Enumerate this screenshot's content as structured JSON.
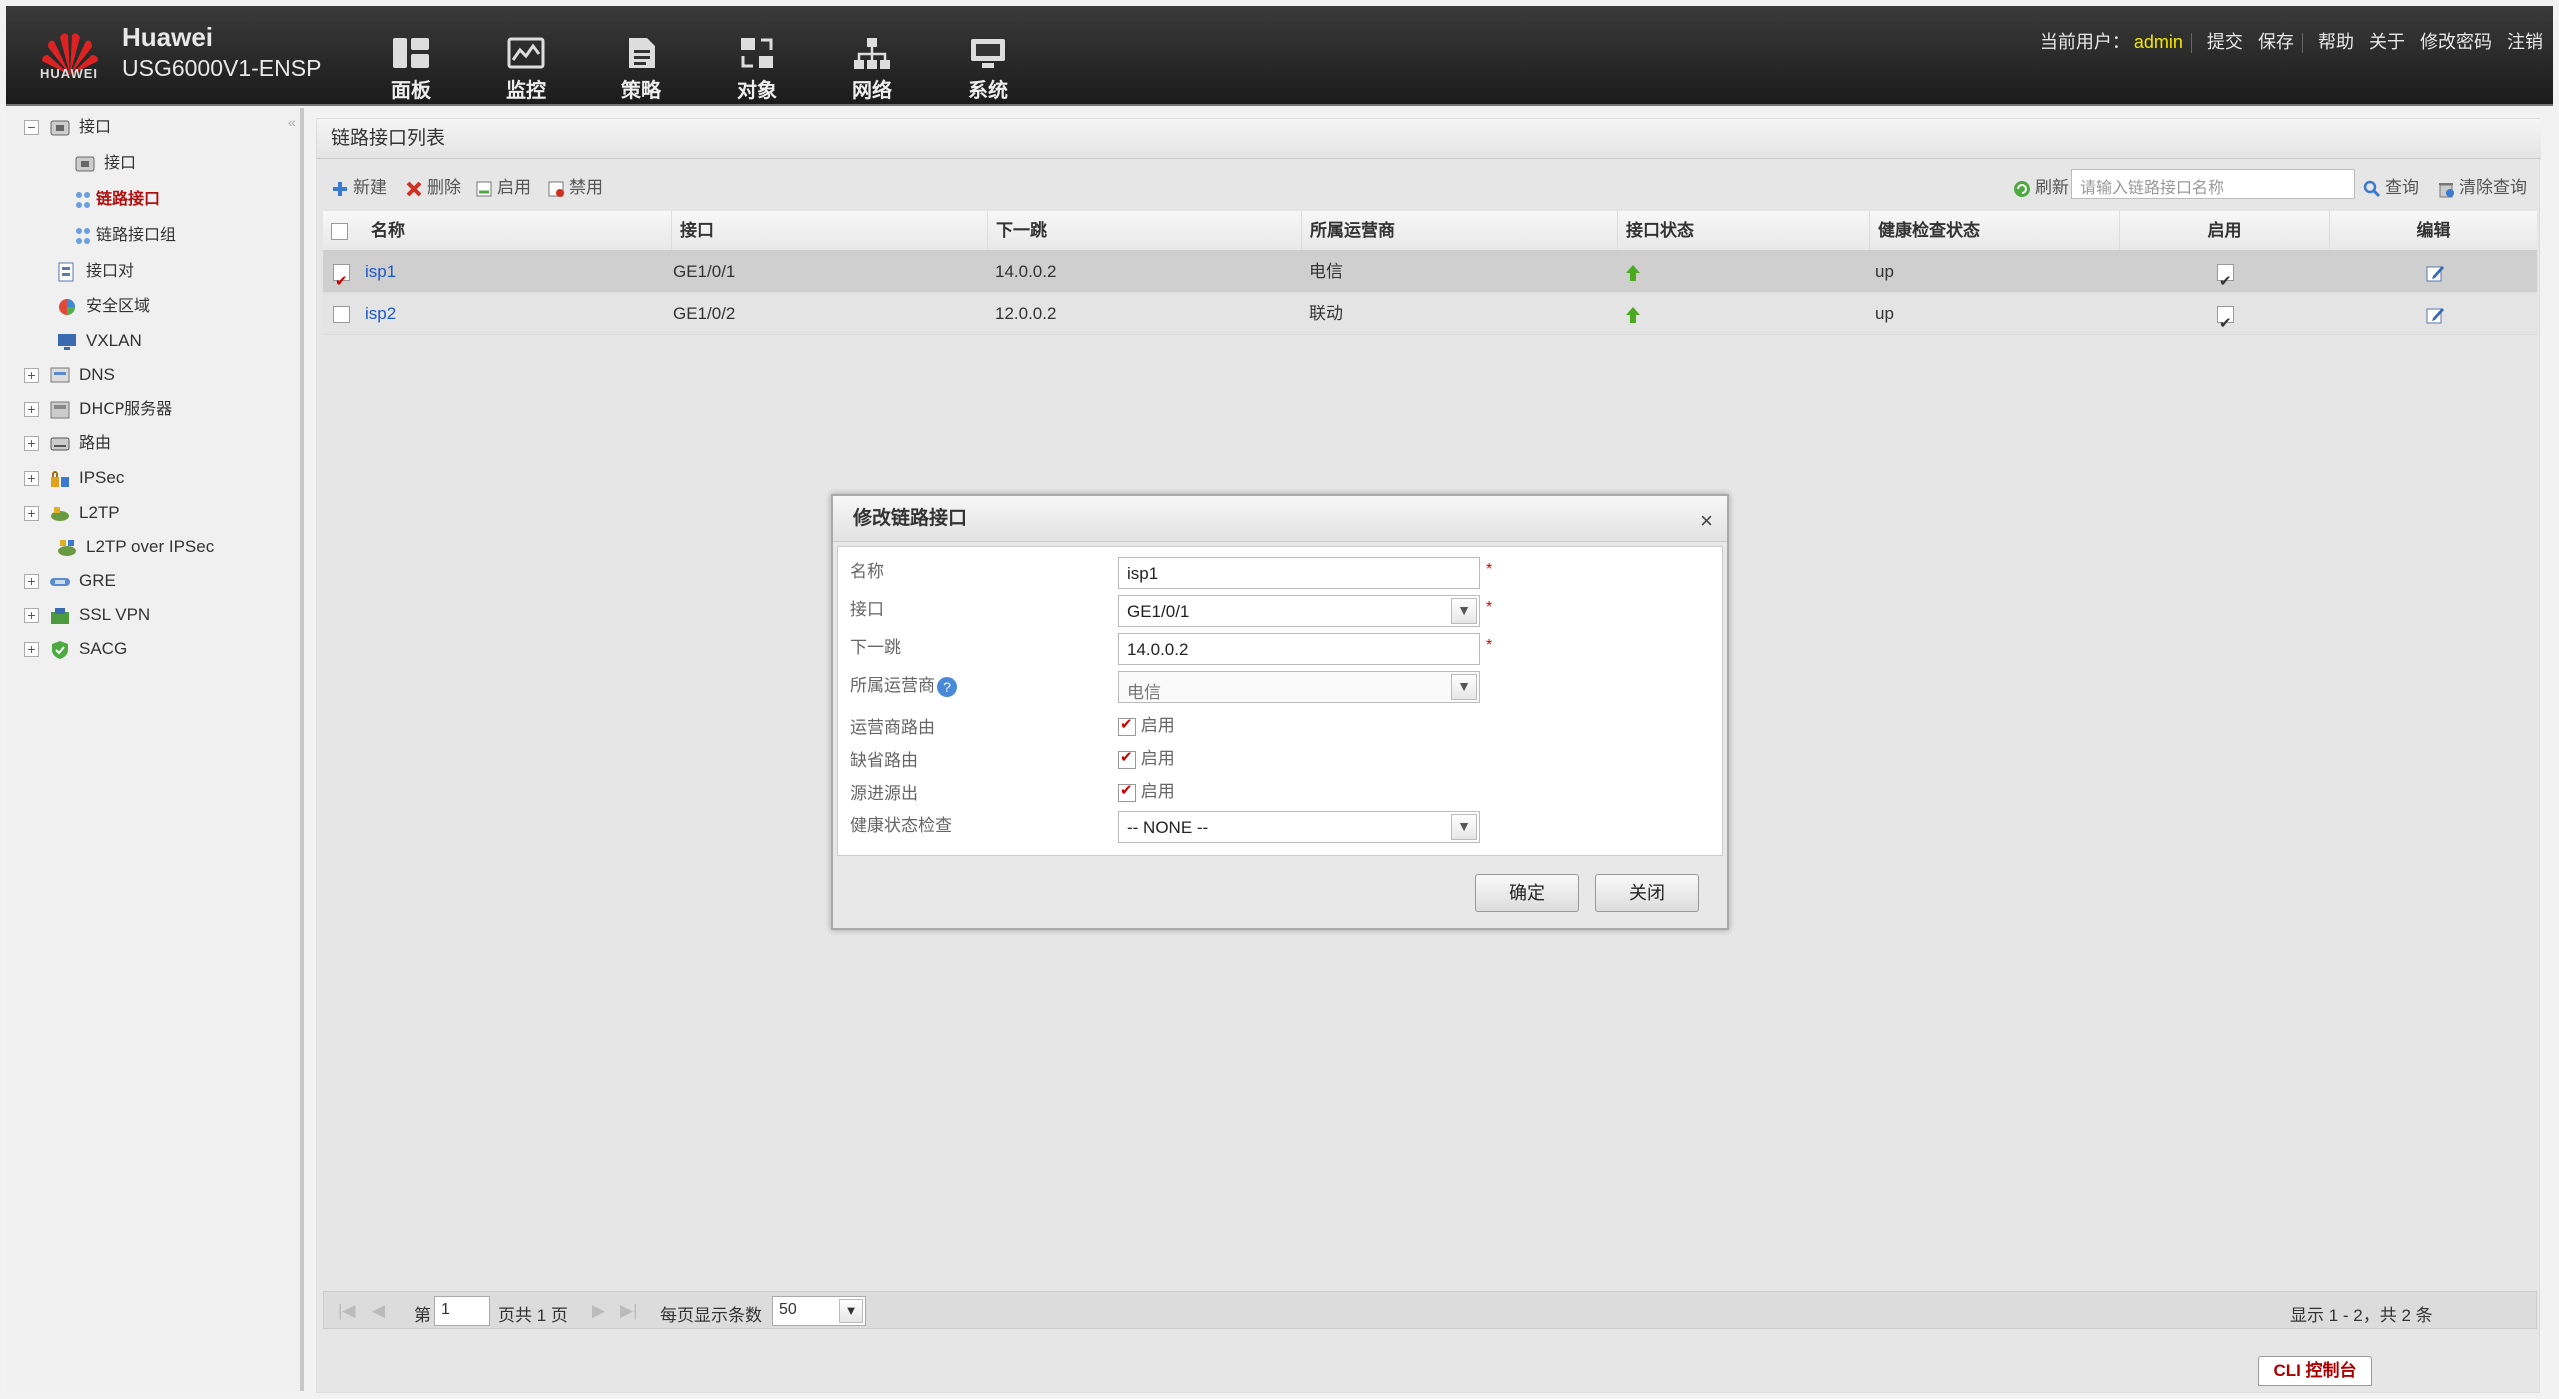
{
  "header": {
    "brand_name": "Huawei",
    "model": "USG6000V1-ENSP",
    "logo_text": "HUAWEI",
    "nav": [
      {
        "label": "面板",
        "icon": "dashboard-icon"
      },
      {
        "label": "监控",
        "icon": "monitor-icon"
      },
      {
        "label": "策略",
        "icon": "policy-icon"
      },
      {
        "label": "对象",
        "icon": "object-icon"
      },
      {
        "label": "网络",
        "icon": "network-icon"
      },
      {
        "label": "系统",
        "icon": "system-icon"
      }
    ],
    "user_label": "当前用户：",
    "user_name": "admin",
    "links": [
      "提交",
      "保存",
      "帮助",
      "关于",
      "修改密码",
      "注销"
    ],
    "user_color": "#f3e800"
  },
  "sidebar": {
    "collapse": "«",
    "items": [
      {
        "label": "接口",
        "pm": "−"
      },
      {
        "label": "接口"
      },
      {
        "label": "链路接口",
        "selected": true
      },
      {
        "label": "链路接口组"
      },
      {
        "label": "接口对"
      },
      {
        "label": "安全区域"
      },
      {
        "label": "VXLAN"
      },
      {
        "label": "DNS",
        "pm": "+"
      },
      {
        "label": "DHCP服务器",
        "pm": "+"
      },
      {
        "label": "路由",
        "pm": "+"
      },
      {
        "label": "IPSec",
        "pm": "+"
      },
      {
        "label": "L2TP",
        "pm": "+"
      },
      {
        "label": "L2TP over IPSec"
      },
      {
        "label": "GRE",
        "pm": "+"
      },
      {
        "label": "SSL VPN",
        "pm": "+"
      },
      {
        "label": "SACG",
        "pm": "+"
      }
    ]
  },
  "main": {
    "title": "链路接口列表",
    "toolbar": {
      "new": "新建",
      "delete": "删除",
      "enable": "启用",
      "disable": "禁用",
      "refresh": "刷新",
      "search_placeholder": "请输入链路接口名称",
      "query": "查询",
      "clear_query": "清除查询"
    },
    "columns": [
      "名称",
      "接口",
      "下一跳",
      "所属运营商",
      "接口状态",
      "健康检查状态",
      "启用",
      "编辑"
    ],
    "rows": [
      {
        "name": "isp1",
        "interface": "GE1/0/1",
        "next_hop": "14.0.0.2",
        "carrier": "电信",
        "status": "up-arrow",
        "health": "up",
        "enabled": true,
        "checked": true
      },
      {
        "name": "isp2",
        "interface": "GE1/0/2",
        "next_hop": "12.0.0.2",
        "carrier": "联动",
        "status": "up-arrow",
        "health": "up",
        "enabled": true,
        "checked": false
      }
    ],
    "pager": {
      "page_prefix": "第",
      "page": "1",
      "page_suffix": "页共 1 页",
      "per_page_label": "每页显示条数",
      "per_page": "50",
      "summary": "显示 1 - 2，共 2 条"
    }
  },
  "cli": "CLI 控制台",
  "dialog": {
    "title": "修改链路接口",
    "close": "×",
    "fields": {
      "name_label": "名称",
      "name_value": "isp1",
      "interface_label": "接口",
      "interface_value": "GE1/0/1",
      "next_hop_label": "下一跳",
      "next_hop_value": "14.0.0.2",
      "carrier_label": "所属运营商",
      "carrier_value": "电信",
      "carrier_route_label": "运营商路由",
      "default_route_label": "缺省路由",
      "source_in_out_label": "源进源出",
      "enable_text": "启用",
      "health_label": "健康状态检查",
      "health_value": "-- NONE --",
      "required": "*",
      "help": "?"
    },
    "ok": "确定",
    "cancel": "关闭"
  }
}
